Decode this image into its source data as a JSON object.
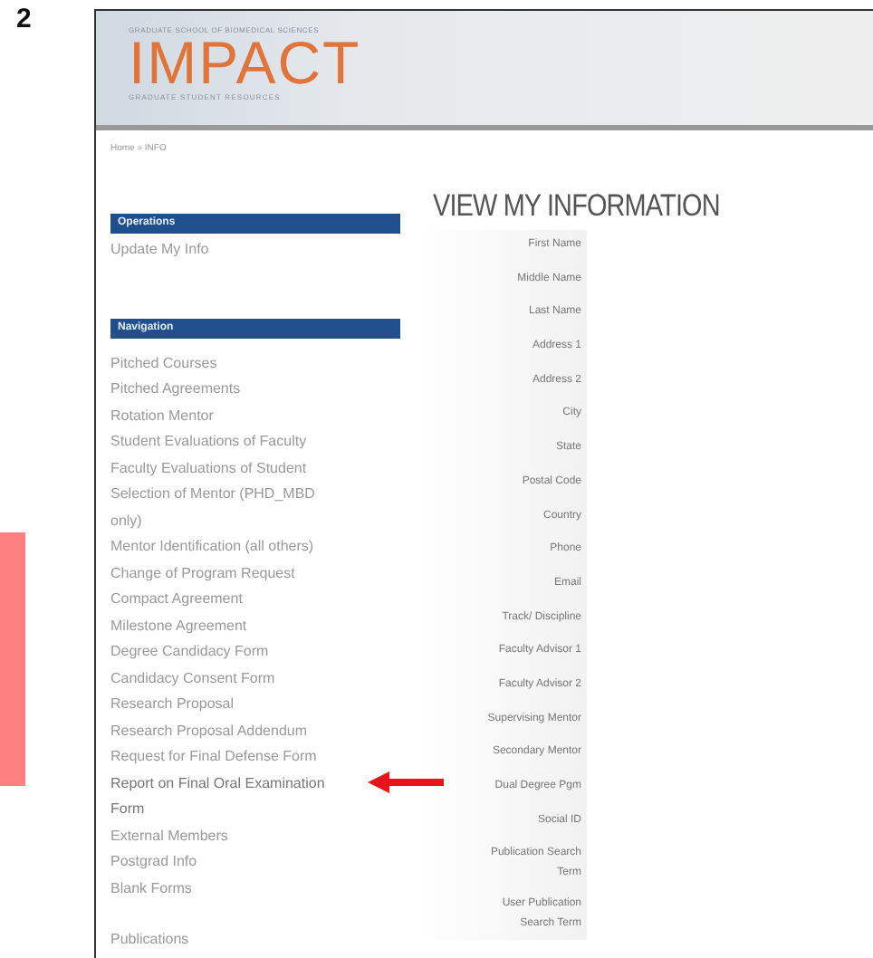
{
  "figure_label": "2",
  "header": {
    "school": "GRADUATE SCHOOL OF BIOMEDICAL SCIENCES",
    "logo": "IMPACT",
    "tagline": "GRADUATE STUDENT RESOURCES"
  },
  "breadcrumb": "Home » INFO",
  "sidebar": {
    "sections": [
      {
        "title": "Operations",
        "items": [
          {
            "label": "Update My Info",
            "highlighted": false
          }
        ]
      },
      {
        "title": "Navigation",
        "items": [
          {
            "label": "Pitched Courses",
            "highlighted": false
          },
          {
            "label": "Pitched Agreements",
            "highlighted": false
          },
          {
            "label": "Rotation Mentor",
            "highlighted": false
          },
          {
            "label": "Student Evaluations of Faculty",
            "highlighted": false
          },
          {
            "label": "Faculty Evaluations of Student",
            "highlighted": false
          },
          {
            "label": "Selection of Mentor (PHD_MBD only)",
            "highlighted": false
          },
          {
            "label": "Mentor Identification (all others)",
            "highlighted": false
          },
          {
            "label": "Change of Program Request",
            "highlighted": false
          },
          {
            "label": "Compact Agreement",
            "highlighted": false
          },
          {
            "label": "Milestone Agreement",
            "highlighted": false
          },
          {
            "label": "Degree Candidacy Form",
            "highlighted": false
          },
          {
            "label": "Candidacy Consent Form",
            "highlighted": false
          },
          {
            "label": "Research Proposal",
            "highlighted": false
          },
          {
            "label": "Research Proposal Addendum",
            "highlighted": false
          },
          {
            "label": "Request for Final Defense Form",
            "highlighted": false
          },
          {
            "label": "Report on Final Oral Examination Form",
            "highlighted": true
          },
          {
            "label": "External Members",
            "highlighted": false
          },
          {
            "label": "Postgrad Info",
            "highlighted": false
          },
          {
            "label": "Blank Forms",
            "highlighted": false
          }
        ]
      },
      {
        "items": [
          {
            "label": "Publications",
            "highlighted": false
          }
        ]
      }
    ]
  },
  "main": {
    "title": "VIEW MY INFORMATION",
    "fields": [
      {
        "label": "First Name"
      },
      {
        "label": "Middle Name"
      },
      {
        "label": "Last Name"
      },
      {
        "label": "Address 1"
      },
      {
        "label": "Address 2"
      },
      {
        "label": "City"
      },
      {
        "label": "State"
      },
      {
        "label": "Postal Code"
      },
      {
        "label": "Country"
      },
      {
        "label": "Phone"
      },
      {
        "label": "Email"
      },
      {
        "label": "Track/ Discipline"
      },
      {
        "label": "Faculty Advisor 1"
      },
      {
        "label": "Faculty Advisor 2"
      },
      {
        "label": "Supervising Mentor"
      },
      {
        "label": "Secondary Mentor"
      },
      {
        "label": "Dual Degree Pgm"
      },
      {
        "label": "Social ID"
      },
      {
        "label": "Publication Search Term"
      },
      {
        "label": "User Publication Search Term"
      }
    ]
  }
}
